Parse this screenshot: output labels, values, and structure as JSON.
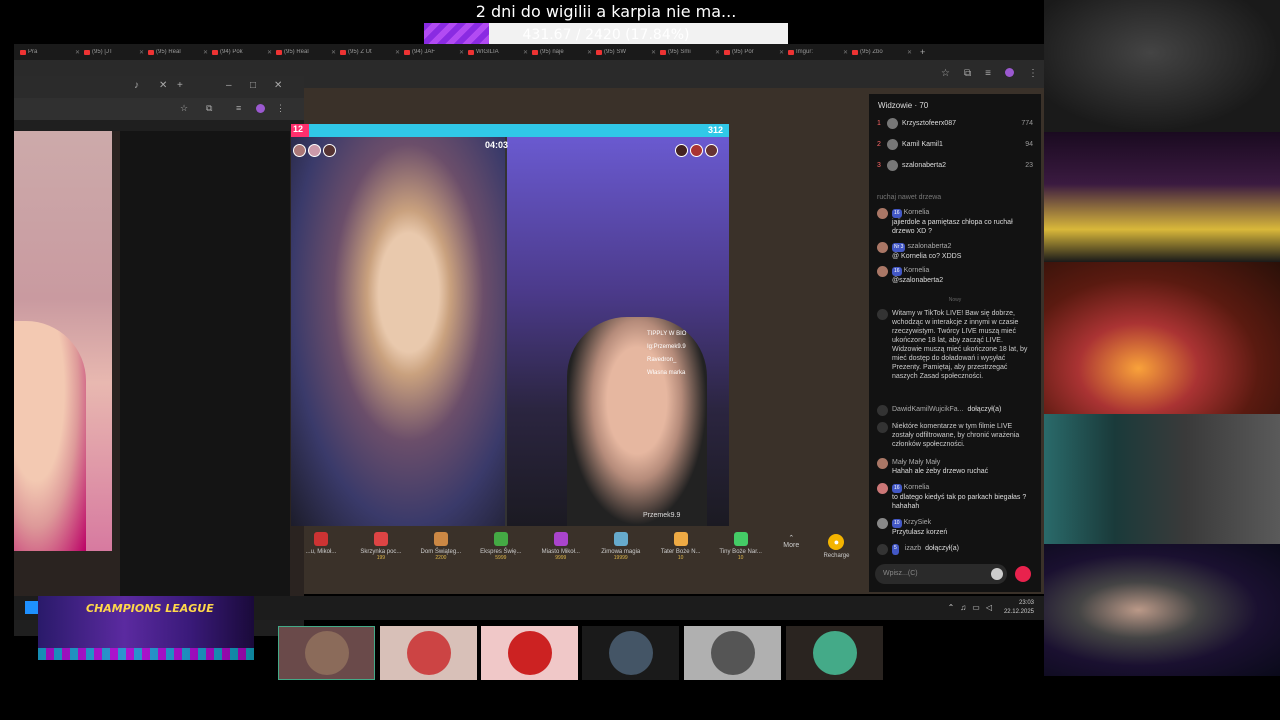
{
  "overlay": {
    "title": "2 dni do wigilii a karpia nie ma...",
    "progress_text": "431.67 / 2420 (17.84%)",
    "progress_fraction": 0.1784,
    "fill_color": "#8a2be2"
  },
  "browser": {
    "tabs": [
      "Pra",
      "(95) [JT",
      "(95) Real",
      "(94) Pok",
      "(95) Real",
      "(95) Z Ut",
      "(94) JAF",
      "WIGILIA",
      "(95) naje",
      "(95) SW",
      "(95) Smi",
      "(95) Por",
      "Imgur:",
      "(95) Zbo"
    ],
    "add_tab": "+"
  },
  "stream": {
    "battle_left": "12",
    "battle_right": "312",
    "battle_left_fraction": 0.04,
    "timer": "04:03",
    "bio_lines": [
      "TIPPLY W BIO",
      "Ig:Przemek9.9",
      "Ravedron_",
      "Własna marka"
    ],
    "handle": "Przemek9.9"
  },
  "gifts": [
    {
      "name": "...u, Mikoł...",
      "price": "",
      "color": "#c33"
    },
    {
      "name": "Skrzynka poc...",
      "price": "199",
      "color": "#d44"
    },
    {
      "name": "Dom Świąteg...",
      "price": "2200",
      "color": "#c84"
    },
    {
      "name": "Ekspres Świę...",
      "price": "5999",
      "color": "#4a4"
    },
    {
      "name": "Miasto Mikoł...",
      "price": "9999",
      "color": "#a4c"
    },
    {
      "name": "Zimowa magia",
      "price": "19999",
      "color": "#6ac"
    },
    {
      "name": "Tater Boże N...",
      "price": "10",
      "color": "#ea4"
    },
    {
      "name": "Tiny Boże Nar...",
      "price": "10",
      "color": "#4c6"
    }
  ],
  "gift_controls": {
    "more": "More",
    "recharge": "Recharge"
  },
  "chat": {
    "viewers_heading": "Widzowie · 70",
    "viewers": [
      {
        "rank": "1",
        "name": "Krzysztofeerx087",
        "count": "774"
      },
      {
        "rank": "2",
        "name": "Kamil Kamil1",
        "count": "94"
      },
      {
        "rank": "3",
        "name": "szalonaberta2",
        "count": "23"
      }
    ],
    "partial_line": "ruchaj nawet drzewa",
    "messages": [
      {
        "badge": "16",
        "name": "Kornelia",
        "text": "jajierdole a pamiętasz chłopa co ruchał drzewo XD ?"
      },
      {
        "badge": "Nr 3",
        "name": "szalonaberta2",
        "text": "@ Kornelia co? XDDS"
      },
      {
        "badge": "16",
        "name": "Kornelia",
        "text": "@szalonaberta2"
      }
    ],
    "new_divider": "Nowy",
    "system_welcome": "Witamy w TikTok LIVE! Baw się dobrze, wchodząc w interakcje z innymi w czasie rzeczywistym. Twórcy LIVE muszą mieć ukończone 18 lat, aby zacząć LIVE. Widzowie muszą mieć ukończone 18 lat, by mieć dostęp do doładowań i wysyłać Prezenty. Pamiętaj, aby przestrzegać naszych Zasad społeczności.",
    "join1_name": "DawidKamilWujcikFa...",
    "join1_action": "dołączył(a)",
    "system_filter": "Niektóre komentarze w tym filmie LIVE zostały odfiltrowane, by chronić wrażenia członków społeczności.",
    "msg4_name": "Mały Mały Mały",
    "msg4_text": "Hahah ale żeby drzewo ruchać",
    "msg5_badge": "16",
    "msg5_name": "Kornelia",
    "msg5_text": "to dlatego kiedyś tak po parkach biegałas ? hahahah",
    "msg6_badge": "10",
    "msg6_name": "KrzySiek",
    "msg6_text": "Przytulasz korzeń",
    "join2_badge": "5",
    "join2_name": "izazb",
    "join2_action": "dołączył(a)",
    "input_placeholder": "Wpisz...(C)"
  },
  "taskbar": {
    "time": "23:03",
    "date": "22.12.2025"
  },
  "banner": {
    "text": "CHAMPIONS LEAGUE"
  },
  "participants": [
    {
      "label": "streamer-face",
      "color": "#8b6b5a",
      "bg": "#6a4a4a"
    },
    {
      "label": "santa-avatar",
      "color": "#c44",
      "bg": "#d8c0b8"
    },
    {
      "label": "neon-avatar",
      "color": "#c22",
      "bg": "#f0c8c8"
    },
    {
      "label": "man-avatar",
      "color": "#456",
      "bg": "#1a1a1a"
    },
    {
      "label": "car-avatar",
      "color": "#555",
      "bg": "#b0b0b0"
    },
    {
      "label": "cartoon-avatar",
      "color": "#4a8",
      "bg": "#2a2420"
    }
  ]
}
